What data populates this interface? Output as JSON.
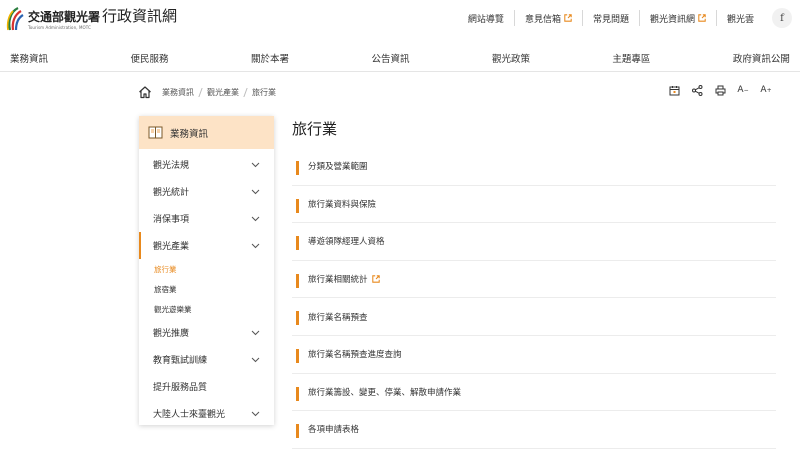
{
  "brand": {
    "org_name": "交通部觀光署",
    "site_name": "行政資訊網",
    "org_name_en": "Tourism Administration, MOTC"
  },
  "utility": [
    {
      "label": "網站導覽",
      "external": false
    },
    {
      "label": "意見信箱",
      "external": true
    },
    {
      "label": "常見問題",
      "external": false
    },
    {
      "label": "觀光資訊網",
      "external": true
    },
    {
      "label": "觀光雲",
      "external": false
    }
  ],
  "social": {
    "facebook_glyph": "f"
  },
  "mainnav": [
    "業務資訊",
    "便民服務",
    "關於本署",
    "公告資訊",
    "觀光政策",
    "主題專區",
    "政府資訊公開"
  ],
  "breadcrumb": [
    "業務資訊",
    "觀光產業",
    "旅行業"
  ],
  "tools": {
    "font_small": "A",
    "font_large": "A"
  },
  "sidebar": {
    "title": "業務資訊",
    "items": [
      {
        "label": "觀光法規",
        "expandable": true
      },
      {
        "label": "觀光統計",
        "expandable": true
      },
      {
        "label": "消保事項",
        "expandable": true
      },
      {
        "label": "觀光產業",
        "expandable": true,
        "active": true
      },
      {
        "label": "觀光推廣",
        "expandable": true
      },
      {
        "label": "教育甄試訓練",
        "expandable": true
      },
      {
        "label": "提升服務品質",
        "expandable": false
      },
      {
        "label": "大陸人士來臺觀光",
        "expandable": true
      }
    ],
    "sub_items": [
      "旅行業",
      "旅宿業",
      "觀光遊樂業"
    ]
  },
  "page_title": "旅行業",
  "content_items": [
    {
      "label": "分類及營業範圍",
      "external": false
    },
    {
      "label": "旅行業資料與保險",
      "external": false
    },
    {
      "label": "導遊領隊經理人資格",
      "external": false
    },
    {
      "label": "旅行業相關統計",
      "external": true
    },
    {
      "label": "旅行業名稱預查",
      "external": false
    },
    {
      "label": "旅行業名稱預查進度查詢",
      "external": false
    },
    {
      "label": "旅行業籌設、變更、停業、解散申請作業",
      "external": false
    },
    {
      "label": "各項申請表格",
      "external": false
    }
  ],
  "colors": {
    "accent": "#e8891d",
    "sidebar_head_bg": "#fde3c6"
  }
}
